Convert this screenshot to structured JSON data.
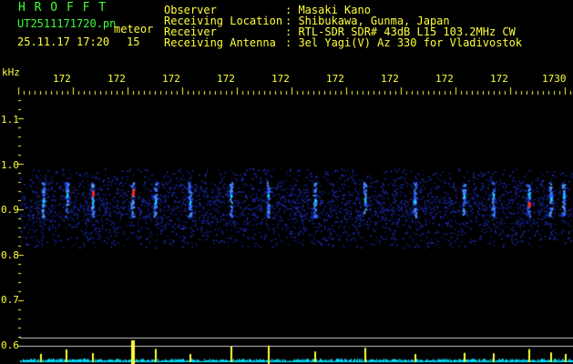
{
  "header": {
    "brand": "H R O F F T",
    "filename": "UT2511171720.pn",
    "datetime": "25.11.17 17:20",
    "minute": "15",
    "tag": "meteor",
    "labels": [
      "Observer",
      "Receiving Location",
      "Receiver",
      "Receiving Antenna"
    ],
    "values": [
      ": Masaki Kano",
      ": Shibukawa, Gunma, Japan",
      ": RTL-SDR SDR# 43dB L15 103.2MHz CW",
      ": 3el Yagi(V) Az 330 for Vladivostok"
    ]
  },
  "time_axis": {
    "ticks": [
      "172",
      "172",
      "172",
      "172",
      "172",
      "172",
      "172",
      "172",
      "172",
      "1730"
    ]
  },
  "freq_axis": {
    "unit": "kHz",
    "ticks": [
      "1.1",
      "1.0",
      "0.9",
      "0.8",
      "0.7",
      "0.6"
    ]
  },
  "colors": {
    "text_green": "#3cff3c",
    "text_yellow": "#ffff3c",
    "signal_blue": "#1e3cff",
    "meteor_red": "#ff2020",
    "trace_cyan": "#00e0ff"
  }
}
